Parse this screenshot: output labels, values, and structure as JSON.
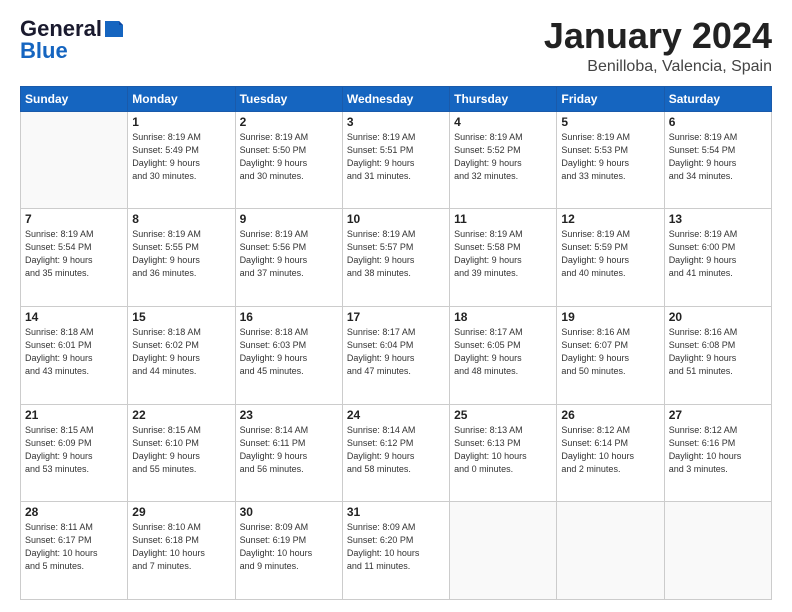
{
  "header": {
    "logo_general": "General",
    "logo_blue": "Blue",
    "month_title": "January 2024",
    "location": "Benilloba, Valencia, Spain"
  },
  "days_of_week": [
    "Sunday",
    "Monday",
    "Tuesday",
    "Wednesday",
    "Thursday",
    "Friday",
    "Saturday"
  ],
  "weeks": [
    [
      {
        "day": "",
        "info": ""
      },
      {
        "day": "1",
        "info": "Sunrise: 8:19 AM\nSunset: 5:49 PM\nDaylight: 9 hours\nand 30 minutes."
      },
      {
        "day": "2",
        "info": "Sunrise: 8:19 AM\nSunset: 5:50 PM\nDaylight: 9 hours\nand 30 minutes."
      },
      {
        "day": "3",
        "info": "Sunrise: 8:19 AM\nSunset: 5:51 PM\nDaylight: 9 hours\nand 31 minutes."
      },
      {
        "day": "4",
        "info": "Sunrise: 8:19 AM\nSunset: 5:52 PM\nDaylight: 9 hours\nand 32 minutes."
      },
      {
        "day": "5",
        "info": "Sunrise: 8:19 AM\nSunset: 5:53 PM\nDaylight: 9 hours\nand 33 minutes."
      },
      {
        "day": "6",
        "info": "Sunrise: 8:19 AM\nSunset: 5:54 PM\nDaylight: 9 hours\nand 34 minutes."
      }
    ],
    [
      {
        "day": "7",
        "info": "Sunrise: 8:19 AM\nSunset: 5:54 PM\nDaylight: 9 hours\nand 35 minutes."
      },
      {
        "day": "8",
        "info": "Sunrise: 8:19 AM\nSunset: 5:55 PM\nDaylight: 9 hours\nand 36 minutes."
      },
      {
        "day": "9",
        "info": "Sunrise: 8:19 AM\nSunset: 5:56 PM\nDaylight: 9 hours\nand 37 minutes."
      },
      {
        "day": "10",
        "info": "Sunrise: 8:19 AM\nSunset: 5:57 PM\nDaylight: 9 hours\nand 38 minutes."
      },
      {
        "day": "11",
        "info": "Sunrise: 8:19 AM\nSunset: 5:58 PM\nDaylight: 9 hours\nand 39 minutes."
      },
      {
        "day": "12",
        "info": "Sunrise: 8:19 AM\nSunset: 5:59 PM\nDaylight: 9 hours\nand 40 minutes."
      },
      {
        "day": "13",
        "info": "Sunrise: 8:19 AM\nSunset: 6:00 PM\nDaylight: 9 hours\nand 41 minutes."
      }
    ],
    [
      {
        "day": "14",
        "info": "Sunrise: 8:18 AM\nSunset: 6:01 PM\nDaylight: 9 hours\nand 43 minutes."
      },
      {
        "day": "15",
        "info": "Sunrise: 8:18 AM\nSunset: 6:02 PM\nDaylight: 9 hours\nand 44 minutes."
      },
      {
        "day": "16",
        "info": "Sunrise: 8:18 AM\nSunset: 6:03 PM\nDaylight: 9 hours\nand 45 minutes."
      },
      {
        "day": "17",
        "info": "Sunrise: 8:17 AM\nSunset: 6:04 PM\nDaylight: 9 hours\nand 47 minutes."
      },
      {
        "day": "18",
        "info": "Sunrise: 8:17 AM\nSunset: 6:05 PM\nDaylight: 9 hours\nand 48 minutes."
      },
      {
        "day": "19",
        "info": "Sunrise: 8:16 AM\nSunset: 6:07 PM\nDaylight: 9 hours\nand 50 minutes."
      },
      {
        "day": "20",
        "info": "Sunrise: 8:16 AM\nSunset: 6:08 PM\nDaylight: 9 hours\nand 51 minutes."
      }
    ],
    [
      {
        "day": "21",
        "info": "Sunrise: 8:15 AM\nSunset: 6:09 PM\nDaylight: 9 hours\nand 53 minutes."
      },
      {
        "day": "22",
        "info": "Sunrise: 8:15 AM\nSunset: 6:10 PM\nDaylight: 9 hours\nand 55 minutes."
      },
      {
        "day": "23",
        "info": "Sunrise: 8:14 AM\nSunset: 6:11 PM\nDaylight: 9 hours\nand 56 minutes."
      },
      {
        "day": "24",
        "info": "Sunrise: 8:14 AM\nSunset: 6:12 PM\nDaylight: 9 hours\nand 58 minutes."
      },
      {
        "day": "25",
        "info": "Sunrise: 8:13 AM\nSunset: 6:13 PM\nDaylight: 10 hours\nand 0 minutes."
      },
      {
        "day": "26",
        "info": "Sunrise: 8:12 AM\nSunset: 6:14 PM\nDaylight: 10 hours\nand 2 minutes."
      },
      {
        "day": "27",
        "info": "Sunrise: 8:12 AM\nSunset: 6:16 PM\nDaylight: 10 hours\nand 3 minutes."
      }
    ],
    [
      {
        "day": "28",
        "info": "Sunrise: 8:11 AM\nSunset: 6:17 PM\nDaylight: 10 hours\nand 5 minutes."
      },
      {
        "day": "29",
        "info": "Sunrise: 8:10 AM\nSunset: 6:18 PM\nDaylight: 10 hours\nand 7 minutes."
      },
      {
        "day": "30",
        "info": "Sunrise: 8:09 AM\nSunset: 6:19 PM\nDaylight: 10 hours\nand 9 minutes."
      },
      {
        "day": "31",
        "info": "Sunrise: 8:09 AM\nSunset: 6:20 PM\nDaylight: 10 hours\nand 11 minutes."
      },
      {
        "day": "",
        "info": ""
      },
      {
        "day": "",
        "info": ""
      },
      {
        "day": "",
        "info": ""
      }
    ]
  ]
}
